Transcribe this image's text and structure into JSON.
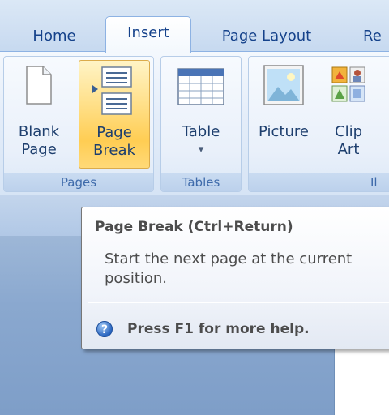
{
  "tabs": {
    "home": "Home",
    "insert": "Insert",
    "page_layout": "Page Layout",
    "references_partial": "Re"
  },
  "ribbon": {
    "pages_group": {
      "label": "Pages",
      "blank_page": "Blank\nPage",
      "page_break": "Page\nBreak"
    },
    "tables_group": {
      "label": "Tables",
      "table": "Table",
      "dropdown_arrow": "▾"
    },
    "illustrations_group": {
      "label_partial": "Il",
      "picture": "Picture",
      "clip_art": "Clip\nArt"
    }
  },
  "tooltip": {
    "title": "Page Break (Ctrl+Return)",
    "description": "Start the next page at the current position.",
    "help": "Press F1 for more help.",
    "help_icon_glyph": "?"
  },
  "colors": {
    "tab_text": "#15428b",
    "highlight": "#ffcd53",
    "tooltip_text": "#4c4c4c"
  }
}
